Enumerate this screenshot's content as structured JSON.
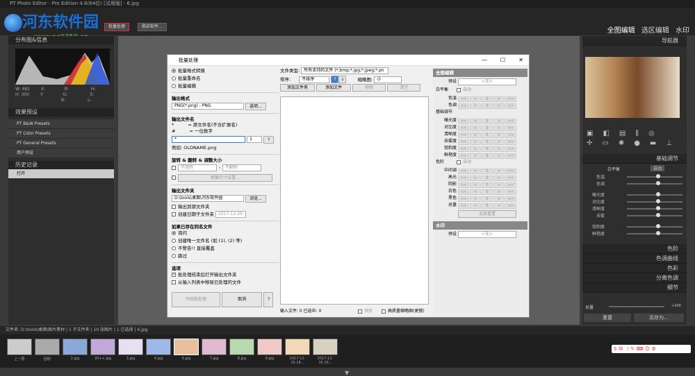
{
  "app": {
    "title": "PT Photo Editor - Pro Edition 4.6(64位) [试用版] - 6.jpg"
  },
  "watermark": {
    "text": "河东软件园",
    "url": "www.pc0359.cn"
  },
  "toolbar": {
    "batch_button": "批量处理",
    "buy_button": "购买软件..."
  },
  "modes": [
    "全图编辑",
    "选区编辑",
    "水印"
  ],
  "left": {
    "histogram_header": "分布图&信息",
    "info": {
      "w_label": "W:",
      "w": "481",
      "h_label": "H:",
      "h": "300",
      "x": "X:",
      "y": "Y:",
      "r": "R:",
      "g": "G:",
      "b": "B:",
      "h2": "H:",
      "s": "S:",
      "l": "L:"
    },
    "presets_header": "效果预设",
    "presets": [
      "PT B&W Presets",
      "PT Color Presets",
      "PT General Presets",
      "用户预设"
    ],
    "history_header": "历史记录",
    "history_items": [
      "打开"
    ]
  },
  "right": {
    "navigator": "导航器",
    "basic": "基础调节",
    "wb_label": "白平衡",
    "wb_btn": "自动",
    "sliders": [
      "色温",
      "色调",
      "曝光度",
      "对比度",
      "清晰度",
      "去雾",
      "饱和度",
      "鲜艳度"
    ],
    "panels": [
      "色阶",
      "色调曲线",
      "色彩",
      "分离色调",
      "细节"
    ],
    "total_label": "总量",
    "total_value": "+100",
    "reset_btn": "重置",
    "saveas_btn": "另存为..."
  },
  "dialog": {
    "title": "批量处理",
    "mode_options": [
      "批量格式转换",
      "批量重命名",
      "批量编辑"
    ],
    "output_format_label": "输出格式",
    "output_format_value": "PNG(*.png) - PNG",
    "options_btn": "选项...",
    "output_name_label": "输出文件名",
    "name_hint1_sym": "*",
    "name_hint1": "= 原文件名(不含扩展名)",
    "name_hint2_sym": "#",
    "name_hint2": "= 一位数字",
    "name_input": "*",
    "name_start": "1",
    "help_btn": "?",
    "example_label": "例如:",
    "example_value": "OLDNAME.png",
    "rotate_label": "旋转 & 翻转 & 调整大小",
    "rotate_sel": "不旋转",
    "flip_sel": "不翻转",
    "resize_btn": "图像尺寸设置...",
    "output_folder_label": "输出文件夹",
    "output_folder_value": "D:\\tools\\桌面\\河东软件园",
    "browse_btn": "浏览...",
    "to_source": "输出到源文件夹",
    "date_folder": "创建日期子文件夹",
    "date_value": "2017-12-29",
    "exist_label": "如果已存在同名文件",
    "exist_options": [
      "询问",
      "创建唯一文件名 (如 (1), (2) 等)",
      "不警告!! 直接覆盖",
      "跳过"
    ],
    "opts_label": "选项",
    "opt1": "批处理结束后打开输出文件夹",
    "opt2": "从输入列表中移除已处理的文件",
    "start_btn": "开始批处理",
    "cancel_btn": "取消",
    "q_btn": "?",
    "file_type_label": "文件类型:",
    "file_type_value": "所有支持的文件 (*.bmp;*.jpg;*.jpeg;*.pn",
    "sort_label": "排序:",
    "sort_value": "不排序",
    "thumb_label": "缩略图:",
    "thumb_value": "小",
    "add_folder_btn": "添加文件夹",
    "add_file_btn": "添加文件",
    "remove_btn": "移除",
    "clear_btn": "清空",
    "status": "输入文件: 0  已选中: 0",
    "preview": "预览",
    "hq_preview": "高质量缩略图(更慢)",
    "global_header": "全图编辑",
    "preset_label": "预设",
    "preset_value": "<无>",
    "wb_label": "白平衡",
    "auto": "自动",
    "wb_rows": [
      "色温",
      "色调"
    ],
    "base_label": "基础调节",
    "base_rows": [
      "曝光度",
      "对比度",
      "清晰度",
      "去雾度",
      "饱和度",
      "鲜艳度"
    ],
    "levels_label": "色阶",
    "levels_rows": [
      "中间调",
      "高光",
      "阴影",
      "白色",
      "黑色"
    ],
    "total_label": "总量",
    "reset_all": "全部重置",
    "watermark_header": "水印",
    "wm_preset_value": "<无>"
  },
  "infobar": {
    "text": "文件夹: D:\\tools\\桌面\\图片素材 | 1 子文件夹 | 10 张图片 | 1 已选择 | 6.jpg"
  },
  "film": [
    "上一层",
    "回收",
    "2.jpg",
    "20++.jpg",
    "3.jpg",
    "4.jpg",
    "6.jpg",
    "7.jpg",
    "8.jpg",
    "9.jpg",
    "2017-12-15.16...",
    "2017-12-15.16..."
  ]
}
